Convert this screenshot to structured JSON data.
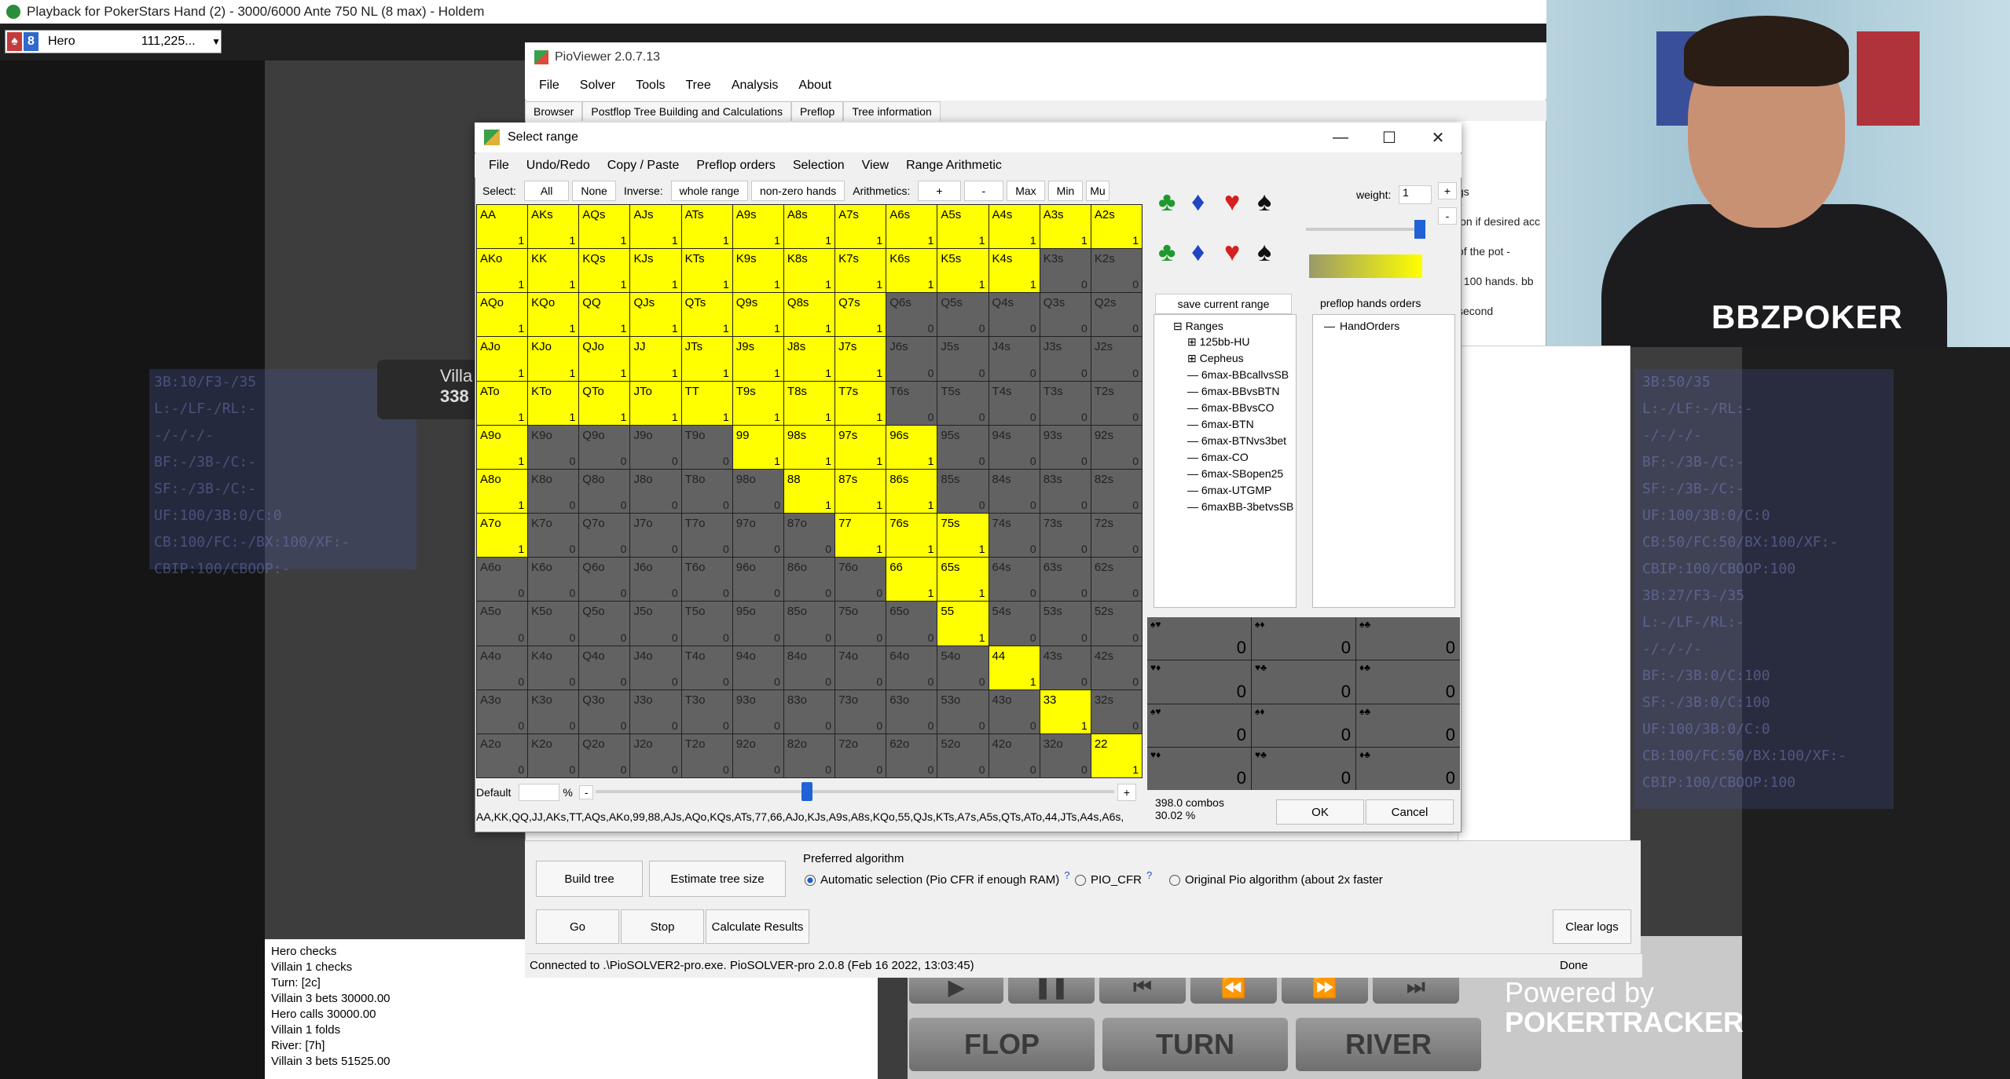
{
  "poker": {
    "title": "Playback for PokerStars Hand (2) - 3000/6000 Ante 750 NL (8 max) - Holdem",
    "hero_badge_left": "♠",
    "hero_badge_right": "8",
    "hero_select_name": "Hero",
    "hero_select_value": "111,225...",
    "villain_name": "Villa",
    "villain_stack": "338",
    "left_hud_lines": [
      "3B:10/F3-/35",
      "L:-/LF-/RL:-",
      "-/-/-/-",
      "BF:-/3B-/C:-",
      "SF:-/3B-/C:-",
      "UF:100/3B:0/C:0",
      "CB:100/FC:-/BX:100/XF:-",
      "CBIP:100/CBOOP:-"
    ],
    "right_hud_lines": [
      "3B:50/35",
      "L:-/LF:-/RL:-",
      "-/-/-/-",
      "BF:-/3B-/C:-",
      "SF:-/3B-/C:-",
      "UF:100/3B:0/C:0",
      "CB:50/FC:50/BX:100/XF:-",
      "CBIP:100/CBOOP:100",
      "3B:27/F3-/35",
      "L:-/LF-/RL:-",
      "-/-/-/-",
      "BF:-/3B:0/C:100",
      "SF:-/3B:0/C:100",
      "UF:100/3B:0/C:0",
      "CB:100/FC:50/BX:100/XF:-",
      "CBIP:100/CBOOP:100"
    ],
    "log_lines": [
      "Hero checks",
      "Villain 1 checks",
      "Turn: [2c]",
      "Villain 3 bets 30000.00",
      "Hero calls 30000.00",
      "Villain 1 folds",
      "River: [7h]",
      "Villain 3 bets 51525.00"
    ],
    "buttons": {
      "flop": "FLOP",
      "turn": "TURN",
      "river": "RIVER"
    },
    "powered_line1": "Powered by",
    "powered_line2": "POKERTRACKER"
  },
  "webcam": {
    "logo": "BBZPOKER"
  },
  "pio": {
    "title": "PioViewer 2.0.7.13",
    "menu": [
      "File",
      "Solver",
      "Tools",
      "Tree",
      "Analysis",
      "About"
    ],
    "tabs": [
      "Browser",
      "Postflop Tree Building and Calculations",
      "Preflop",
      "Tree information"
    ],
    "right_texts": [
      "gs",
      "ion if desired acc",
      "of the pot  -",
      "/ 100 hands. bb",
      "second"
    ],
    "build_tree": "Build tree",
    "estimate_tree": "Estimate tree size",
    "go": "Go",
    "stop": "Stop",
    "calc": "Calculate Results",
    "clear_logs": "Clear logs",
    "preferred_algorithm": "Preferred algorithm",
    "algo_auto": "Automatic selection (Pio CFR if enough RAM)",
    "algo_cfr": "PIO_CFR",
    "algo_orig": "Original Pio algorithm (about 2x faster",
    "help": "?",
    "status": "Connected to .\\PioSOLVER2-pro.exe. PioSOLVER-pro 2.0.8 (Feb 16 2022, 13:03:45)",
    "done": "Done"
  },
  "dialog": {
    "title": "Select range",
    "menu": [
      "File",
      "Undo/Redo",
      "Copy / Paste",
      "Preflop orders",
      "Selection",
      "View",
      "Range Arithmetic"
    ],
    "select_label": "Select:",
    "select_all": "All",
    "select_none": "None",
    "inverse_label": "Inverse:",
    "whole_range": "whole range",
    "nonzero": "non-zero hands",
    "arith_label": "Arithmetics:",
    "plus": "+",
    "minus": "-",
    "max": "Max",
    "min": "Min",
    "mu": "Mu",
    "weight_label": "weight:",
    "weight_value": "1",
    "save_range": "save current range",
    "preflop_orders": "preflop hands orders",
    "tree_root": "Ranges",
    "tree_items": [
      "125bb-HU",
      "Cepheus",
      "6max-BBcallvsSB",
      "6max-BBvsBTN",
      "6max-BBvsCO",
      "6max-BTN",
      "6max-BTNvs3bet",
      "6max-CO",
      "6max-SBopen25",
      "6max-UTGMP",
      "6maxBB-3betvsSB"
    ],
    "orders_item": "HandOrders",
    "default_label": "Default",
    "pct": "%",
    "range_text": "AA,KK,QQ,JJ,AKs,TT,AQs,AKo,99,88,AJs,AQo,KQs,ATs,77,66,AJo,KJs,A9s,A8s,KQo,55,QJs,KTs,A7s,A5s,QTs,ATo,44,JTs,A4s,A6s,",
    "combos": "398.0 combos",
    "combos_pct": "30.02 %",
    "ok": "OK",
    "cancel": "Cancel",
    "combo_values": [
      "0",
      "0",
      "0",
      "0",
      "0",
      "0",
      "0",
      "0",
      "0",
      "0",
      "0",
      "0"
    ],
    "combo_labels": [
      "♠♥",
      "♠♦",
      "♠♣",
      "♥♦",
      "♥♣",
      "♦♣",
      "♠♥",
      "♠♦",
      "♠♣",
      "♥♦",
      "♥♣",
      "♦♣"
    ]
  },
  "range_grid": {
    "ranks": [
      "A",
      "K",
      "Q",
      "J",
      "T",
      "9",
      "8",
      "7",
      "6",
      "5",
      "4",
      "3",
      "2"
    ],
    "selected": [
      "AA",
      "AKs",
      "AQs",
      "AJs",
      "ATs",
      "A9s",
      "A8s",
      "A7s",
      "A6s",
      "A5s",
      "A4s",
      "A3s",
      "A2s",
      "AKo",
      "KK",
      "KQs",
      "KJs",
      "KTs",
      "K9s",
      "K8s",
      "K7s",
      "K6s",
      "K5s",
      "K4s",
      "AQo",
      "KQo",
      "QQ",
      "QJs",
      "QTs",
      "Q9s",
      "Q8s",
      "Q7s",
      "AJo",
      "KJo",
      "QJo",
      "JJ",
      "JTs",
      "J9s",
      "J8s",
      "J7s",
      "ATo",
      "KTo",
      "QTo",
      "JTo",
      "TT",
      "T9s",
      "T8s",
      "T7s",
      "A9o",
      "99",
      "98s",
      "97s",
      "96s",
      "A8o",
      "88",
      "87s",
      "86s",
      "A7o",
      "77",
      "76s",
      "75s",
      "66",
      "65s",
      "55",
      "44",
      "33",
      "22"
    ]
  },
  "colors": {
    "selected": "#ffff00",
    "unselected": "#626262",
    "accent": "#1f63d6"
  },
  "icons": {
    "club": "club-icon",
    "diamond": "diamond-icon",
    "heart": "heart-icon",
    "spade": "spade-icon"
  }
}
